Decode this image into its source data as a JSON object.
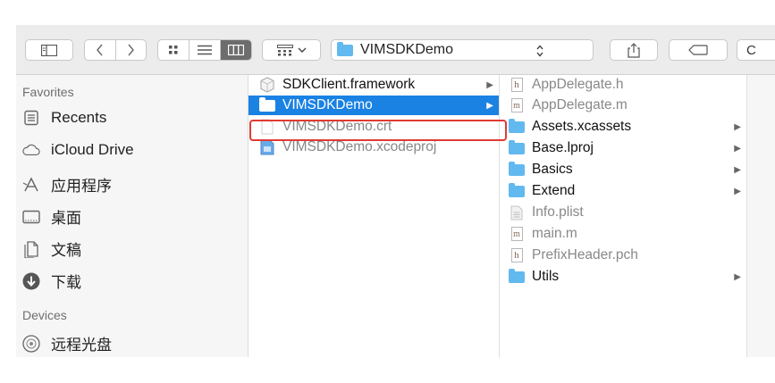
{
  "toolbar": {
    "path_label": "VIMSDKDemo",
    "search_placeholder_visible": "C"
  },
  "sidebar": {
    "favorites_header": "Favorites",
    "favorites": [
      {
        "label": "Recents",
        "icon": "recents-icon"
      },
      {
        "label": "iCloud Drive",
        "icon": "cloud-icon"
      },
      {
        "label": "应用程序",
        "icon": "applications-icon"
      },
      {
        "label": "桌面",
        "icon": "desktop-icon"
      },
      {
        "label": "文稿",
        "icon": "documents-icon"
      },
      {
        "label": "下载",
        "icon": "downloads-icon"
      }
    ],
    "devices_header": "Devices",
    "devices": [
      {
        "label": "远程光盘",
        "icon": "disc-icon"
      }
    ]
  },
  "column2": {
    "items": [
      {
        "label": "SDKClient.framework",
        "icon": "framework-icon",
        "has_children": true,
        "selected": false
      },
      {
        "label": "VIMSDKDemo",
        "icon": "folder-icon",
        "has_children": true,
        "selected": true
      },
      {
        "label": "VIMSDKDemo.crt",
        "icon": "certificate-file-icon",
        "has_children": false,
        "selected": false,
        "dimmed": true
      },
      {
        "label": "VIMSDKDemo.xcodeproj",
        "icon": "xcodeproj-icon",
        "has_children": false,
        "selected": false,
        "dimmed": true
      }
    ]
  },
  "column3": {
    "items": [
      {
        "label": "AppDelegate.h",
        "icon": "h-file-icon",
        "has_children": false,
        "dimmed": true
      },
      {
        "label": "AppDelegate.m",
        "icon": "m-file-icon",
        "has_children": false,
        "dimmed": true
      },
      {
        "label": "Assets.xcassets",
        "icon": "folder-icon",
        "has_children": true,
        "dimmed": false
      },
      {
        "label": "Base.lproj",
        "icon": "folder-icon",
        "has_children": true,
        "dimmed": false
      },
      {
        "label": "Basics",
        "icon": "folder-icon",
        "has_children": true,
        "dimmed": false
      },
      {
        "label": "Extend",
        "icon": "folder-icon",
        "has_children": true,
        "dimmed": false
      },
      {
        "label": "Info.plist",
        "icon": "plist-file-icon",
        "has_children": false,
        "dimmed": true
      },
      {
        "label": "main.m",
        "icon": "m-file-icon",
        "has_children": false,
        "dimmed": true
      },
      {
        "label": "PrefixHeader.pch",
        "icon": "h-file-icon",
        "has_children": false,
        "dimmed": true
      },
      {
        "label": "Utils",
        "icon": "folder-icon",
        "has_children": true,
        "dimmed": false
      }
    ]
  },
  "colors": {
    "selection": "#1a82e2",
    "folder": "#61b9ef",
    "highlight_box": "#e23a35",
    "toolbar_bg": "#ececec",
    "sidebar_bg": "#f6f6f6"
  }
}
